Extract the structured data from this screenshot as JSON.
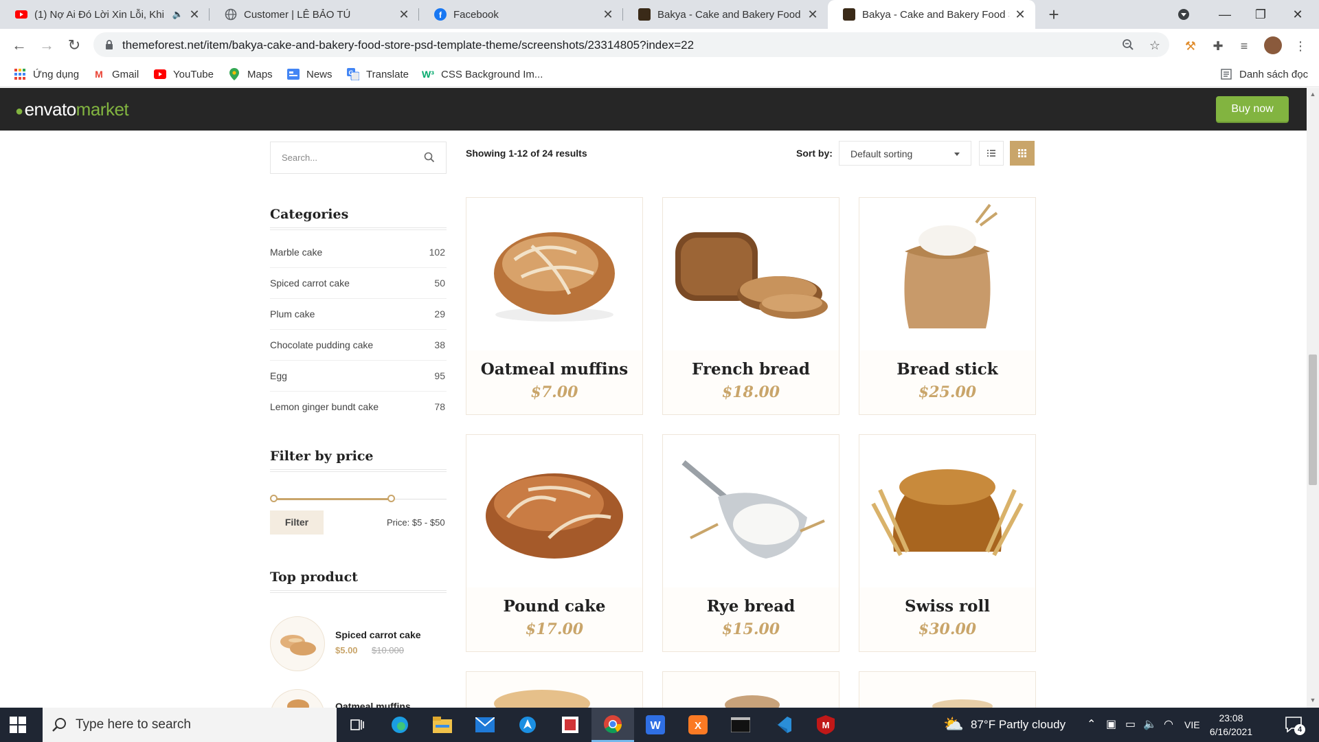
{
  "browser": {
    "tabs": [
      {
        "title": "(1) Nợ Ai Đó Lời Xin Lỗi, Khi",
        "favicon": "youtube-icon",
        "audio": true
      },
      {
        "title": "Customer | LÊ BẢO TÚ",
        "favicon": "globe-icon"
      },
      {
        "title": "Facebook",
        "favicon": "facebook-icon"
      },
      {
        "title": "Bakya - Cake and Bakery Food St",
        "favicon": "bakya-icon"
      },
      {
        "title": "Bakya - Cake and Bakery Food St",
        "favicon": "bakya-icon",
        "active": true
      }
    ],
    "url": "themeforest.net/item/bakya-cake-and-bakery-food-store-psd-template-theme/screenshots/23314805?index=22",
    "bookmarks": [
      {
        "label": "Ứng dụng",
        "icon": "apps-grid-icon"
      },
      {
        "label": "Gmail",
        "icon": "gmail-icon"
      },
      {
        "label": "YouTube",
        "icon": "youtube-icon"
      },
      {
        "label": "Maps",
        "icon": "maps-icon"
      },
      {
        "label": "News",
        "icon": "news-icon"
      },
      {
        "label": "Translate",
        "icon": "translate-icon"
      },
      {
        "label": "CSS Background Im...",
        "icon": "w3-icon"
      }
    ],
    "reading_list": "Danh sách đọc"
  },
  "envato": {
    "logo_word": "envato",
    "logo_market": "market",
    "buy_now": "Buy now",
    "accent": "#82b440"
  },
  "shop": {
    "search_placeholder": "Search...",
    "results_text": "Showing 1-12 of 24 results",
    "sort_label": "Sort by:",
    "sort_value": "Default sorting",
    "accent": "#c9a56a",
    "categories_title": "Categories",
    "categories": [
      {
        "name": "Marble cake",
        "count": "102"
      },
      {
        "name": "Spiced carrot cake",
        "count": "50"
      },
      {
        "name": "Plum cake",
        "count": "29"
      },
      {
        "name": "Chocolate pudding cake",
        "count": "38"
      },
      {
        "name": "Egg",
        "count": "95"
      },
      {
        "name": "Lemon ginger bundt cake",
        "count": "78"
      }
    ],
    "filter_title": "Filter by price",
    "filter_button": "Filter",
    "price_range": "Price: $5 - $50",
    "top_product_title": "Top product",
    "top_products": [
      {
        "name": "Spiced carrot cake",
        "price": "$5.00",
        "old_price": "$10.000"
      },
      {
        "name": "Oatmeal muffins",
        "price": "",
        "old_price": ""
      }
    ],
    "products": [
      {
        "name": "Oatmeal muffins",
        "price": "$7.00",
        "image": "round-loaf"
      },
      {
        "name": "French bread",
        "price": "$18.00",
        "image": "sliced-grain-loaf"
      },
      {
        "name": "Bread stick",
        "price": "$25.00",
        "image": "flour-bag"
      },
      {
        "name": "Pound cake",
        "price": "$17.00",
        "image": "rustic-loaf"
      },
      {
        "name": "Rye bread",
        "price": "$15.00",
        "image": "flour-scoop"
      },
      {
        "name": "Swiss roll",
        "price": "$30.00",
        "image": "wheat-loaf"
      }
    ]
  },
  "taskbar": {
    "search_placeholder": "Type here to search",
    "weather": "87°F  Partly cloudy",
    "language": "VIE",
    "time": "23:08",
    "date": "6/16/2021",
    "notifications": "4"
  }
}
